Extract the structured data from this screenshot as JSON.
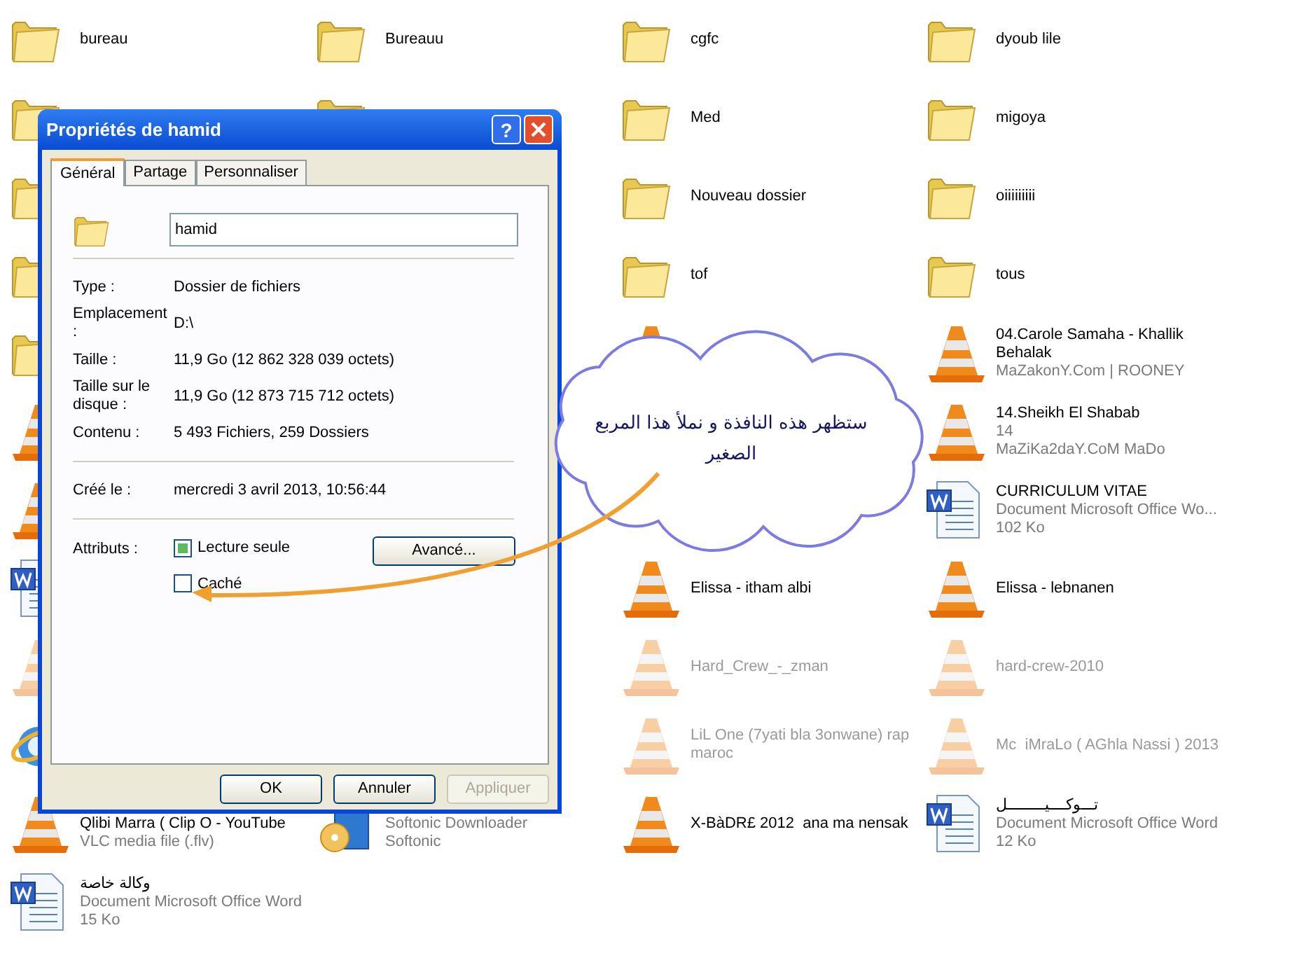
{
  "desktop": {
    "columns": [
      {
        "items": [
          {
            "kind": "folder",
            "name": "bureau"
          },
          {
            "kind": "folder"
          },
          {
            "kind": "folder"
          },
          {
            "kind": "folder"
          },
          {
            "kind": "folder"
          },
          {
            "kind": "vlc"
          },
          {
            "kind": "vlc"
          },
          {
            "kind": "word"
          },
          {
            "kind": "vlc",
            "faded": true
          },
          {
            "kind": "browser"
          },
          {
            "kind": "vlc",
            "name": "Qlibi Marra ( Clip O - YouTube",
            "details": [
              "VLC media file (.flv)"
            ]
          },
          {
            "kind": "word",
            "name": "وكالة خاصة",
            "details": [
              "Document Microsoft Office Word",
              "15 Ko"
            ]
          }
        ]
      },
      {
        "items": [
          {
            "kind": "folder",
            "name": "Bureauu"
          },
          {
            "kind": "folder"
          },
          {
            "kind": "blank"
          },
          {
            "kind": "blank"
          },
          {
            "kind": "blank"
          },
          {
            "kind": "blank"
          },
          {
            "kind": "blank"
          },
          {
            "kind": "blank"
          },
          {
            "kind": "blank"
          },
          {
            "kind": "blank"
          },
          {
            "kind": "installer",
            "details": [
              "Softonic Downloader",
              "Softonic"
            ]
          }
        ]
      },
      {
        "items": [
          {
            "kind": "folder",
            "name": "cgfc"
          },
          {
            "kind": "folder",
            "name": "Med"
          },
          {
            "kind": "folder",
            "name": "Nouveau dossier"
          },
          {
            "kind": "folder",
            "name": "tof"
          },
          {
            "kind": "vlc"
          },
          {
            "kind": "blank"
          },
          {
            "kind": "blank"
          },
          {
            "kind": "vlc",
            "name": "Elissa - itham albi"
          },
          {
            "kind": "vlc",
            "faded": true,
            "name": "Hard_Crew_-_zman"
          },
          {
            "kind": "vlc",
            "faded": true,
            "name": "LiL One (7yati bla 3onwane) rap maroc"
          },
          {
            "kind": "vlc",
            "name": "X-BàDR£ 2012  ana ma nensak"
          }
        ]
      },
      {
        "items": [
          {
            "kind": "folder",
            "name": "dyoub lile"
          },
          {
            "kind": "folder",
            "name": "migoya"
          },
          {
            "kind": "folder",
            "name": "oiiiiiiiii"
          },
          {
            "kind": "folder",
            "name": "tous"
          },
          {
            "kind": "vlc",
            "name": "04.Carole Samaha - Khallik Behalak",
            "details": [
              "MaZakonY.Com | ROONEY"
            ]
          },
          {
            "kind": "vlc",
            "name": "14.Sheikh El Shabab",
            "details": [
              "14",
              "MaZiKa2daY.CoM MaDo"
            ]
          },
          {
            "kind": "word",
            "name": "CURRICULUM VITAE",
            "details": [
              "Document Microsoft Office Wo...",
              "102 Ko"
            ]
          },
          {
            "kind": "vlc",
            "name": "Elissa - lebnanen"
          },
          {
            "kind": "vlc",
            "faded": true,
            "name": "hard-crew-2010"
          },
          {
            "kind": "vlc",
            "faded": true,
            "name": "Mc  iMraLo ( AGhla Nassi ) 2013"
          },
          {
            "kind": "word",
            "name": "تـــوكــــيـــــــــل",
            "details": [
              "Document Microsoft Office Word",
              "12 Ko"
            ]
          }
        ]
      }
    ]
  },
  "dialog": {
    "title": "Propriétés de hamid",
    "help_button": "?",
    "tabs": [
      {
        "label": "Général",
        "selected": true
      },
      {
        "label": "Partage",
        "selected": false
      },
      {
        "label": "Personnaliser",
        "selected": false
      }
    ],
    "name_field": {
      "value": "hamid"
    },
    "sections": [
      [
        {
          "label": "Type :",
          "value": "Dossier de fichiers"
        },
        {
          "label": "Emplacement :",
          "value": "D:\\"
        },
        {
          "label": "Taille :",
          "value": "11,9 Go (12 862 328 039 octets)"
        },
        {
          "label": "Taille sur le disque :",
          "value": "11,9 Go (12 873 715 712 octets)"
        },
        {
          "label": "Contenu :",
          "value": "5 493 Fichiers, 259 Dossiers"
        }
      ],
      [
        {
          "label": "Créé le :",
          "value": "mercredi 3 avril 2013, 10:56:44"
        }
      ]
    ],
    "attributes": {
      "label": "Attributs :",
      "checkboxes": [
        {
          "label": "Lecture seule",
          "checked": true
        },
        {
          "label": "Caché",
          "checked": false
        }
      ],
      "advanced_button": "Avancé..."
    },
    "buttons": [
      {
        "label": "OK",
        "disabled": false
      },
      {
        "label": "Annuler",
        "disabled": false
      },
      {
        "label": "Appliquer",
        "disabled": true
      }
    ]
  },
  "callout": {
    "text": "ستظهر  هذه النافذة و نملأ هذا المربع الصغير"
  }
}
